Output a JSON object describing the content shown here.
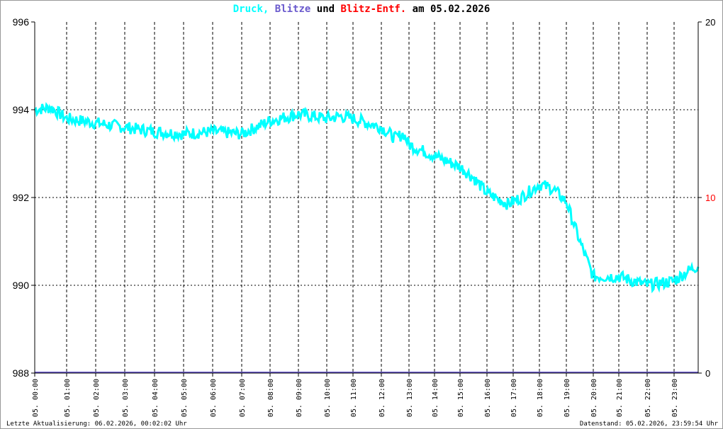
{
  "chart_data": {
    "type": "line",
    "title_parts": [
      {
        "text": "Druck,",
        "color": "#00ffff"
      },
      {
        "text": "Blitze",
        "color": "#6a5acd"
      },
      {
        "text": "und",
        "color": "#000000"
      },
      {
        "text": "Blitz-Entf.",
        "color": "#ff0000"
      },
      {
        "text": "am 05.02.2026",
        "color": "#000000"
      }
    ],
    "ylim_left": [
      988,
      996
    ],
    "yticks_left": [
      "988",
      "990",
      "992",
      "994",
      "996"
    ],
    "ylim_right": [
      0,
      20
    ],
    "yticks_right": [
      {
        "label": "0",
        "color": "#000000",
        "v": 0
      },
      {
        "label": "10",
        "color": "#ff0000",
        "v": 10
      },
      {
        "label": "20",
        "color": "#000000",
        "v": 20
      }
    ],
    "xticks": [
      "05. 00:00",
      "05. 01:00",
      "05. 02:00",
      "05. 03:00",
      "05. 04:00",
      "05. 05:00",
      "05. 06:00",
      "05. 07:00",
      "05. 08:00",
      "05. 09:00",
      "05. 10:00",
      "05. 11:00",
      "05. 12:00",
      "05. 13:00",
      "05. 14:00",
      "05. 15:00",
      "05. 16:00",
      "05. 17:00",
      "05. 18:00",
      "05. 19:00",
      "05. 20:00",
      "05. 21:00",
      "05. 22:00",
      "05. 23:00"
    ],
    "grid": true,
    "series": [
      {
        "name": "Druck",
        "color": "#00ffff",
        "points_hour_hpa": [
          [
            0,
            994.0
          ],
          [
            0.5,
            994.05
          ],
          [
            1,
            993.8
          ],
          [
            2,
            993.7
          ],
          [
            3,
            993.6
          ],
          [
            4,
            993.5
          ],
          [
            5,
            993.45
          ],
          [
            6,
            993.5
          ],
          [
            7,
            993.45
          ],
          [
            7.5,
            993.6
          ],
          [
            8,
            993.75
          ],
          [
            9,
            993.9
          ],
          [
            10,
            993.8
          ],
          [
            10.5,
            993.85
          ],
          [
            11,
            993.8
          ],
          [
            12,
            993.6
          ],
          [
            12.5,
            993.35
          ],
          [
            12.8,
            993.45
          ],
          [
            13,
            993.2
          ],
          [
            14,
            992.95
          ],
          [
            15,
            992.7
          ],
          [
            15.5,
            992.45
          ],
          [
            16,
            992.1
          ],
          [
            16.8,
            991.85
          ],
          [
            17.3,
            992.0
          ],
          [
            18,
            992.3
          ],
          [
            18.5,
            992.2
          ],
          [
            19,
            991.9
          ],
          [
            19.5,
            991.0
          ],
          [
            20,
            990.2
          ],
          [
            21,
            990.2
          ],
          [
            22,
            990.0
          ],
          [
            23,
            990.1
          ],
          [
            23.5,
            990.3
          ],
          [
            24,
            990.45
          ]
        ]
      },
      {
        "name": "Blitze",
        "color": "#6a5acd",
        "constant": 0
      }
    ]
  },
  "footer": {
    "left": "Letzte Aktualisierung: 06.02.2026, 00:02:02 Uhr",
    "right": "Datenstand: 05.02.2026, 23:59:54 Uhr"
  }
}
